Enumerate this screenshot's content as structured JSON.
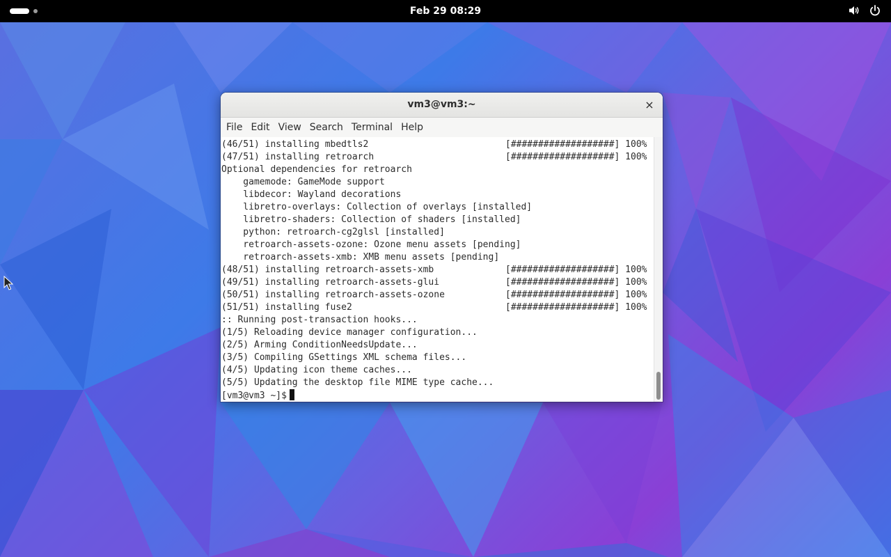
{
  "topbar": {
    "clock": "Feb 29  08:29",
    "icons": [
      "activities-indicator",
      "volume-icon",
      "power-icon"
    ]
  },
  "colors": {
    "topbar_bg": "#000000",
    "terminal_bg": "#ffffff",
    "terminal_text": "#2b2b2b"
  },
  "window": {
    "title": "vm3@vm3:~",
    "close_label": "×"
  },
  "menu": [
    "File",
    "Edit",
    "View",
    "Search",
    "Terminal",
    "Help"
  ],
  "terminal": {
    "lines": [
      {
        "text": "(46/51) installing mbedtls2",
        "progress": "[###################] 100%"
      },
      {
        "text": "(47/51) installing retroarch",
        "progress": "[###################] 100%"
      },
      {
        "text": "Optional dependencies for retroarch",
        "progress": ""
      },
      {
        "text": "    gamemode: GameMode support",
        "progress": ""
      },
      {
        "text": "    libdecor: Wayland decorations",
        "progress": ""
      },
      {
        "text": "    libretro-overlays: Collection of overlays [installed]",
        "progress": ""
      },
      {
        "text": "    libretro-shaders: Collection of shaders [installed]",
        "progress": ""
      },
      {
        "text": "    python: retroarch-cg2glsl [installed]",
        "progress": ""
      },
      {
        "text": "    retroarch-assets-ozone: Ozone menu assets [pending]",
        "progress": ""
      },
      {
        "text": "    retroarch-assets-xmb: XMB menu assets [pending]",
        "progress": ""
      },
      {
        "text": "(48/51) installing retroarch-assets-xmb",
        "progress": "[###################] 100%"
      },
      {
        "text": "(49/51) installing retroarch-assets-glui",
        "progress": "[###################] 100%"
      },
      {
        "text": "(50/51) installing retroarch-assets-ozone",
        "progress": "[###################] 100%"
      },
      {
        "text": "(51/51) installing fuse2",
        "progress": "[###################] 100%"
      },
      {
        "text": ":: Running post-transaction hooks...",
        "progress": ""
      },
      {
        "text": "(1/5) Reloading device manager configuration...",
        "progress": ""
      },
      {
        "text": "(2/5) Arming ConditionNeedsUpdate...",
        "progress": ""
      },
      {
        "text": "(3/5) Compiling GSettings XML schema files...",
        "progress": ""
      },
      {
        "text": "(4/5) Updating icon theme caches...",
        "progress": ""
      },
      {
        "text": "(5/5) Updating the desktop file MIME type cache...",
        "progress": ""
      }
    ],
    "prompt": "[vm3@vm3 ~]$"
  }
}
